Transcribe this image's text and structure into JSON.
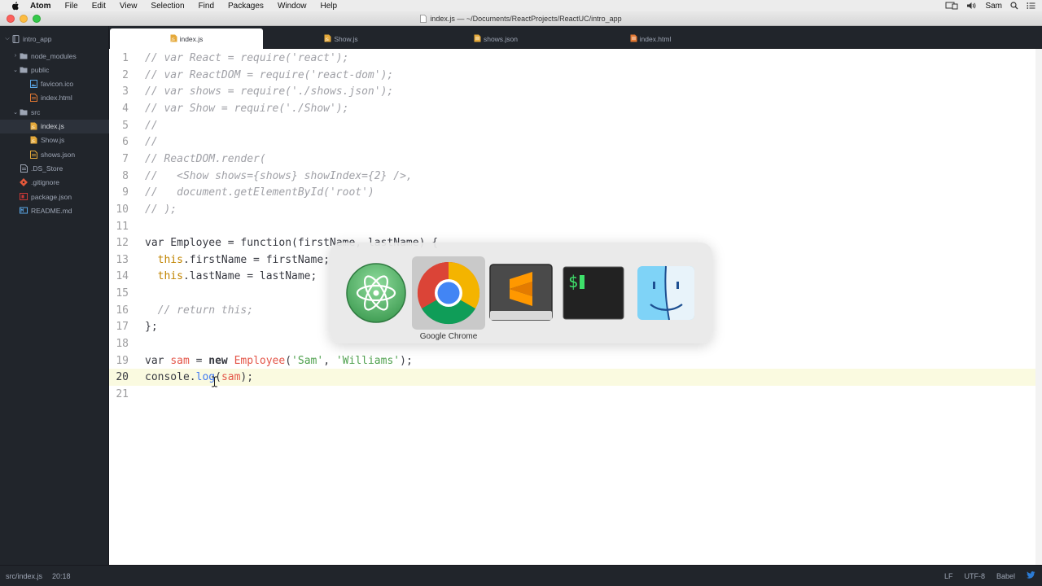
{
  "menubar": {
    "app_name": "Atom",
    "items": [
      "File",
      "Edit",
      "View",
      "Selection",
      "Find",
      "Packages",
      "Window",
      "Help"
    ],
    "user": "Sam"
  },
  "window": {
    "title": "index.js — ~/Documents/ReactProjects/ReactUC/intro_app"
  },
  "tree": {
    "root": "intro_app",
    "items": [
      {
        "label": "node_modules",
        "type": "folder-collapsed",
        "indent": 1
      },
      {
        "label": "public",
        "type": "folder-open",
        "indent": 1
      },
      {
        "label": "favicon.ico",
        "type": "image-file",
        "indent": 2
      },
      {
        "label": "index.html",
        "type": "html-file",
        "indent": 2
      },
      {
        "label": "src",
        "type": "folder-open",
        "indent": 1
      },
      {
        "label": "index.js",
        "type": "js-file",
        "indent": 2,
        "selected": true
      },
      {
        "label": "Show.js",
        "type": "js-file",
        "indent": 2
      },
      {
        "label": "shows.json",
        "type": "json-file",
        "indent": 2
      },
      {
        "label": ".DS_Store",
        "type": "text-file",
        "indent": 1
      },
      {
        "label": ".gitignore",
        "type": "git-file",
        "indent": 1
      },
      {
        "label": "package.json",
        "type": "npm-file",
        "indent": 1
      },
      {
        "label": "README.md",
        "type": "markdown-file",
        "indent": 1
      }
    ]
  },
  "tabs": [
    {
      "label": "index.js",
      "active": true
    },
    {
      "label": "Show.js",
      "active": false
    },
    {
      "label": "shows.json",
      "active": false
    },
    {
      "label": "index.html",
      "active": false
    }
  ],
  "editor": {
    "current_line": 20,
    "lines": [
      "// var React = require('react');",
      "// var ReactDOM = require('react-dom');",
      "// var shows = require('./shows.json');",
      "// var Show = require('./Show');",
      "//",
      "//",
      "// ReactDOM.render(",
      "//   <Show shows={shows} showIndex={2} />,",
      "//   document.getElementById('root')",
      "// );",
      "",
      "var Employee = function(firstName, lastName) {",
      "  this.firstName = firstName;",
      "  this.lastName = lastName;",
      "",
      "  // return this;",
      "};",
      "",
      "var sam = new Employee('Sam', 'Williams');",
      "console.log(sam);",
      ""
    ],
    "line_numbers": [
      "1",
      "2",
      "3",
      "4",
      "5",
      "6",
      "7",
      "8",
      "9",
      "10",
      "11",
      "12",
      "13",
      "14",
      "15",
      "16",
      "17",
      "18",
      "19",
      "20",
      "21"
    ]
  },
  "app_switcher": {
    "apps": [
      {
        "name": "Atom",
        "icon": "atom-icon"
      },
      {
        "name": "Google Chrome",
        "icon": "chrome-icon"
      },
      {
        "name": "Sublime Text",
        "icon": "sublime-icon"
      },
      {
        "name": "Terminal",
        "icon": "terminal-icon"
      },
      {
        "name": "Finder",
        "icon": "finder-icon"
      }
    ],
    "selected_label": "Google Chrome"
  },
  "statusbar": {
    "file_path": "src/index.js",
    "cursor_position": "20:18",
    "line_ending": "LF",
    "encoding": "UTF-8",
    "grammar": "Babel"
  },
  "colors": {
    "sidebar_bg": "#21252b",
    "editor_bg": "#ffffff",
    "comment": "#a0a1a7",
    "string": "#50a14f",
    "variable": "#e45649",
    "this_keyword": "#c18401"
  }
}
